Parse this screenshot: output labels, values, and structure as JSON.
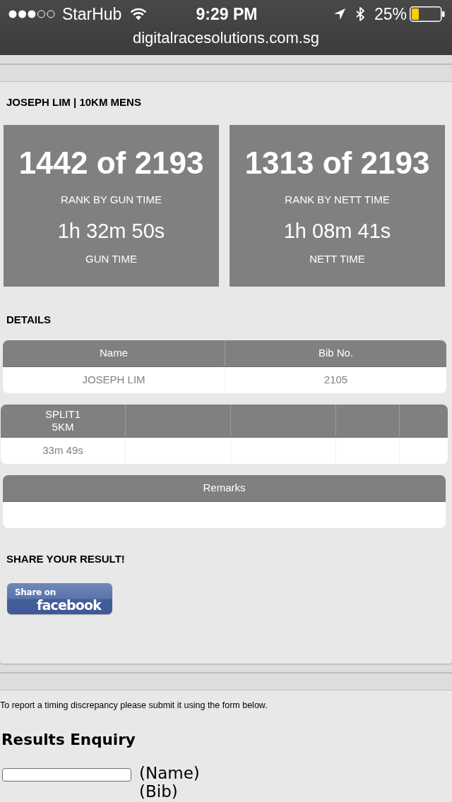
{
  "status_bar": {
    "carrier": "StarHub",
    "time": "9:29 PM",
    "battery": "25%"
  },
  "address_bar": {
    "url": "digitalracesolutions.com.sg"
  },
  "result": {
    "heading": "JOSEPH LIM | 10KM MENS",
    "cards": [
      {
        "rank": "1442 of 2193",
        "rank_label": "RANK BY GUN TIME",
        "time": "1h 32m 50s",
        "time_label": "GUN TIME"
      },
      {
        "rank": "1313 of 2193",
        "rank_label": "RANK BY NETT TIME",
        "time": "1h 08m 41s",
        "time_label": "NETT TIME"
      }
    ]
  },
  "details": {
    "heading": "DETAILS",
    "info_table": {
      "columns": [
        "Name",
        "Bib No."
      ],
      "rows": [
        [
          "JOSEPH LIM",
          "2105"
        ]
      ]
    },
    "splits_table": {
      "columns": [
        {
          "kind": "split",
          "heading": "SPLIT1\n5KM",
          "value": "33m 49s"
        },
        {
          "kind": "blank"
        },
        {
          "kind": "blank"
        },
        {
          "kind": "blank"
        },
        {
          "kind": "blank"
        }
      ]
    },
    "remarks_table": {
      "columns": [
        "Remarks"
      ]
    }
  },
  "share": {
    "heading": "SHARE YOUR RESULT!",
    "button": {
      "line_1": "Share on",
      "line_2": "facebook"
    }
  },
  "enquiry": {
    "note": "To report a timing discrepancy please submit it using the form below.",
    "title": "Results Enquiry",
    "fields": [
      {
        "kind": "input",
        "label": "(Name)"
      },
      {
        "kind": "label",
        "label": "(Bib)"
      }
    ]
  }
}
